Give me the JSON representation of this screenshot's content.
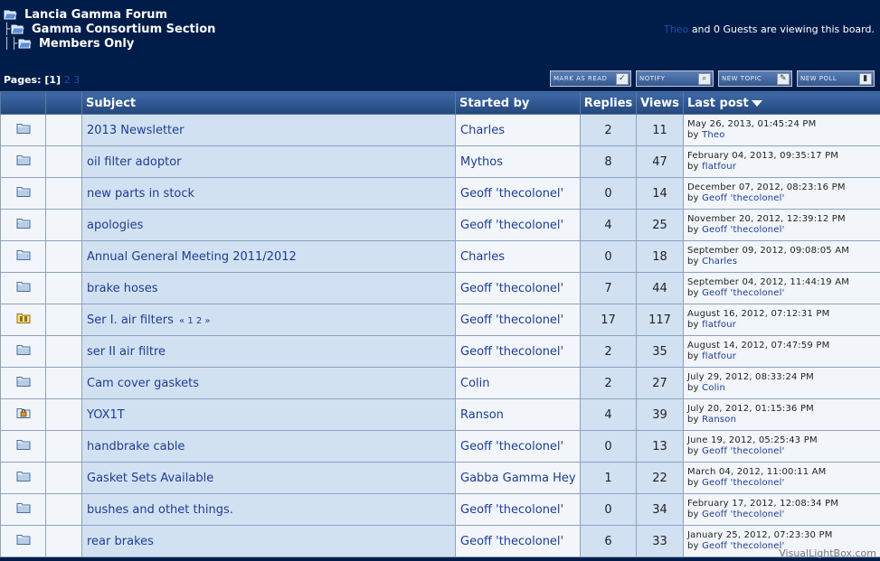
{
  "tree": {
    "forum": "Lancia Gamma Forum",
    "section": "Gamma Consortium Section",
    "board": "Members Only"
  },
  "viewers": {
    "user": "Theo",
    "rest": "and 0 Guests are viewing this board."
  },
  "pagination": {
    "label": "Pages:",
    "current": "[1]",
    "next": "2 3"
  },
  "toolbar": {
    "mark_read": "MARK AS READ",
    "notify": "NOTIFY",
    "new_topic": "NEW TOPIC",
    "new_poll": "NEW POLL"
  },
  "columns": {
    "subject": "Subject",
    "started_by": "Started by",
    "replies": "Replies",
    "views": "Views",
    "last_post": "Last post"
  },
  "by_label": "by",
  "topics": [
    {
      "icon": "folder",
      "subject": "2013 Newsletter",
      "pages": "",
      "starter": "Charles",
      "replies": "2",
      "views": "11",
      "last_date": "May 26, 2013, 01:45:24 PM",
      "last_by": "Theo"
    },
    {
      "icon": "folder",
      "subject": "oil filter adoptor",
      "pages": "",
      "starter": "Mythos",
      "replies": "8",
      "views": "47",
      "last_date": "February 04, 2013, 09:35:17 PM",
      "last_by": "flatfour"
    },
    {
      "icon": "folder",
      "subject": "new parts in stock",
      "pages": "",
      "starter": "Geoff 'thecolonel'",
      "replies": "0",
      "views": "14",
      "last_date": "December 07, 2012, 08:23:16 PM",
      "last_by": "Geoff 'thecolonel'"
    },
    {
      "icon": "folder",
      "subject": "apologies",
      "pages": "",
      "starter": "Geoff 'thecolonel'",
      "replies": "4",
      "views": "25",
      "last_date": "November 20, 2012, 12:39:12 PM",
      "last_by": "Geoff 'thecolonel'"
    },
    {
      "icon": "folder",
      "subject": "Annual General Meeting 2011/2012",
      "pages": "",
      "starter": "Charles",
      "replies": "0",
      "views": "18",
      "last_date": "September 09, 2012, 09:08:05 AM",
      "last_by": "Charles"
    },
    {
      "icon": "folder",
      "subject": "brake hoses",
      "pages": "",
      "starter": "Geoff 'thecolonel'",
      "replies": "7",
      "views": "44",
      "last_date": "September 04, 2012, 11:44:19 AM",
      "last_by": "Geoff 'thecolonel'"
    },
    {
      "icon": "hot",
      "subject": "Ser I. air filters",
      "pages": "« 1 2 »",
      "starter": "Geoff 'thecolonel'",
      "replies": "17",
      "views": "117",
      "last_date": "August 16, 2012, 07:12:31 PM",
      "last_by": "flatfour"
    },
    {
      "icon": "folder",
      "subject": "ser II air filtre",
      "pages": "",
      "starter": "Geoff 'thecolonel'",
      "replies": "2",
      "views": "35",
      "last_date": "August 14, 2012, 07:47:59 PM",
      "last_by": "flatfour"
    },
    {
      "icon": "folder",
      "subject": "Cam cover gaskets",
      "pages": "",
      "starter": "Colin",
      "replies": "2",
      "views": "27",
      "last_date": "July 29, 2012, 08:33:24 PM",
      "last_by": "Colin"
    },
    {
      "icon": "locked",
      "subject": "YOX1T",
      "pages": "",
      "starter": "Ranson",
      "replies": "4",
      "views": "39",
      "last_date": "July 20, 2012, 01:15:36 PM",
      "last_by": "Ranson"
    },
    {
      "icon": "folder",
      "subject": "handbrake cable",
      "pages": "",
      "starter": "Geoff 'thecolonel'",
      "replies": "0",
      "views": "13",
      "last_date": "June 19, 2012, 05:25:43 PM",
      "last_by": "Geoff 'thecolonel'"
    },
    {
      "icon": "folder",
      "subject": "Gasket Sets Available",
      "pages": "",
      "starter": "Gabba Gamma Hey",
      "replies": "1",
      "views": "22",
      "last_date": "March 04, 2012, 11:00:11 AM",
      "last_by": "Geoff 'thecolonel'"
    },
    {
      "icon": "folder",
      "subject": "bushes and othet things.",
      "pages": "",
      "starter": "Geoff 'thecolonel'",
      "replies": "0",
      "views": "34",
      "last_date": "February 17, 2012, 12:08:34 PM",
      "last_by": "Geoff 'thecolonel'"
    },
    {
      "icon": "folder",
      "subject": "rear brakes",
      "pages": "",
      "starter": "Geoff 'thecolonel'",
      "replies": "6",
      "views": "33",
      "last_date": "January 25, 2012, 07:23:30 PM",
      "last_by": "Geoff 'thecolonel'"
    }
  ],
  "watermark": "VisualLightBox.com"
}
